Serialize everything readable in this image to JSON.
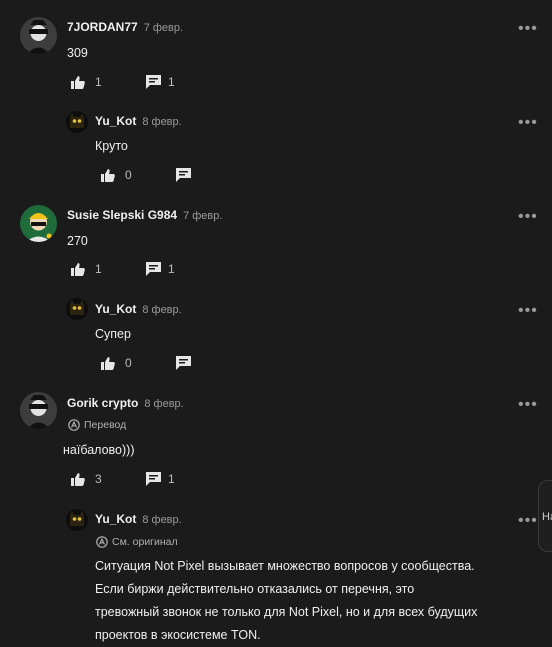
{
  "comments": [
    {
      "author": "7JORDAN77",
      "date": "7 февр.",
      "text": "309",
      "likes": "1",
      "replies": "1",
      "avatar": "robber-mask-avatar"
    },
    {
      "author": "Yu_Kot",
      "date": "8 февр.",
      "text": "Круто",
      "likes": "0",
      "avatar": "cat-avatar"
    },
    {
      "author": "Susie Slepski G984",
      "date": "7 февр.",
      "text": "270",
      "likes": "1",
      "replies": "1",
      "avatar": "helmet-avatar"
    },
    {
      "author": "Yu_Kot",
      "date": "8 февр.",
      "text": "Супер",
      "likes": "0",
      "avatar": "cat-avatar"
    },
    {
      "author": "Gorik crypto",
      "date": "8 февр.",
      "translation_label": "Перевод",
      "text": "наїбалово)))",
      "likes": "3",
      "replies": "1",
      "avatar": "robber-mask-avatar"
    },
    {
      "author": "Yu_Kot",
      "date": "8 февр.",
      "translation_label": "См. оригинал",
      "text_lines": [
        "Ситуация Not Pixel вызывает множество вопросов у сообщества.",
        "Если биржи действительно отказались от перечня, это",
        "тревожный звонок не только для Not Pixel, но и для всех будущих",
        "проектов в экосистеме TON."
      ],
      "avatar": "cat-avatar"
    }
  ],
  "more_glyph": "•••",
  "edge_label": "На",
  "colors": {
    "background": "#1b1b1b",
    "text": "#f0f0f0",
    "muted": "#9a9a9a"
  }
}
